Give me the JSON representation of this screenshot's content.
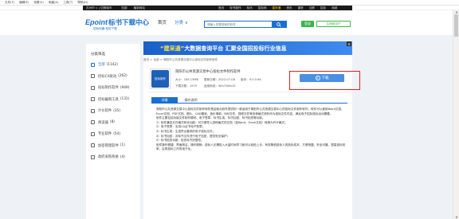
{
  "browser_menu": [
    "文件(F)",
    "编辑(E)",
    "查看(V)",
    "收藏(A)",
    "工具(T)",
    "帮助(H)"
  ],
  "site_topbar": {
    "location": "苏州市 ∨ | 切换城市",
    "left_links": [
      "四部",
      "最新网站"
    ],
    "nav": [
      "首页",
      "标书制作",
      "标讯",
      "招标网",
      "建采通",
      "资讯",
      "课堂",
      "互联",
      "招标",
      "商城"
    ],
    "highlighted_nav": "建采通"
  },
  "header": {
    "logo_en": "Epoint",
    "logo_cn": "标书下载中心",
    "logo_sub": "招标利器  轻松下载",
    "nav": [
      "首页",
      "分类 ∨"
    ],
    "search_placeholder": "请输入您要搜索的软件",
    "search_icon": "search-icon",
    "login_label": "登录",
    "register_label": "注册新用户"
  },
  "sidebar": {
    "title": "分类筛选",
    "items": [
      {
        "label": "全部",
        "count": "(1142)",
        "icon": "grid-icon"
      },
      {
        "label": "招标CA驱动",
        "count": "(262)",
        "icon": "key-icon"
      },
      {
        "label": "投标制作软件",
        "count": "(949)",
        "icon": "tool-icon"
      },
      {
        "label": "招标编制工具",
        "count": "(131)",
        "icon": "tool-icon"
      },
      {
        "label": "计价软件",
        "count": "(35)",
        "icon": "calc-icon"
      },
      {
        "label": "阅读器",
        "count": "(8)",
        "icon": "book-icon"
      },
      {
        "label": "专业软件",
        "count": "(54)",
        "icon": "box-icon"
      },
      {
        "label": "加密管理软件",
        "count": "(1)",
        "icon": "lock-icon"
      },
      {
        "label": "政府采购系统",
        "count": "(4)",
        "icon": "building-icon"
      }
    ]
  },
  "banner": {
    "part1": "“建采通”",
    "part2": "大数据查询平台  汇聚全国招投标行业信息",
    "close": "×"
  },
  "breadcrumb": "首页 > 全部 > 简阳市公共资源交易中心投标文件制作软件",
  "app": {
    "name": "简阳市公共资源交易中心投标文件制作软件",
    "icon_text": "投标制作",
    "size": "大小：185.15MB",
    "updated": "更新日期：2022-07-08",
    "version": "版本：9.0.0.64",
    "downloads": "下载次数：1979",
    "platform": "适用系统：Win7/Win10",
    "download_label": "下载"
  },
  "tabs": [
    "详情",
    "操作说明"
  ],
  "description": [
    "简阳市公共资源交易中心投标文件制作软件是由新点软件提供的一款适用于简阳市公共资源交易中心的投标文件制作软件，软件可以使用Word文档、Excel文档、PDF文档、图片、CAD图纸、造价清单、BIM文件、视频文件等多种格式资料作为投标文件内容，满足电子招标投标活动需要。",
    "软件主要包括功能文件制作模块、电子签章、标书生成、标书加密、标书检查等功能。",
    "1）软件兼容文件格式转化功能：可方便导入其他格式的文档（如Word、Excel文档）转换为PDF格式；",
    "2）电子签章：支持CA证书电子签章；",
    "3）标书生成：生成符合要求的电子投标文件；",
    "4）标书加密：对标书文件进行电子加密，提供安全保护；",
    "5）标书检查功能：检查标书完整性。",
    "软件操作便捷、界面简洁，操作顺畅，投标人无需投入大量时间学习就可以轻松上手，有效降低投标人的投标成本，方便快捷，安全可靠，提高投标效率，实现投标工作的电子化。"
  ]
}
